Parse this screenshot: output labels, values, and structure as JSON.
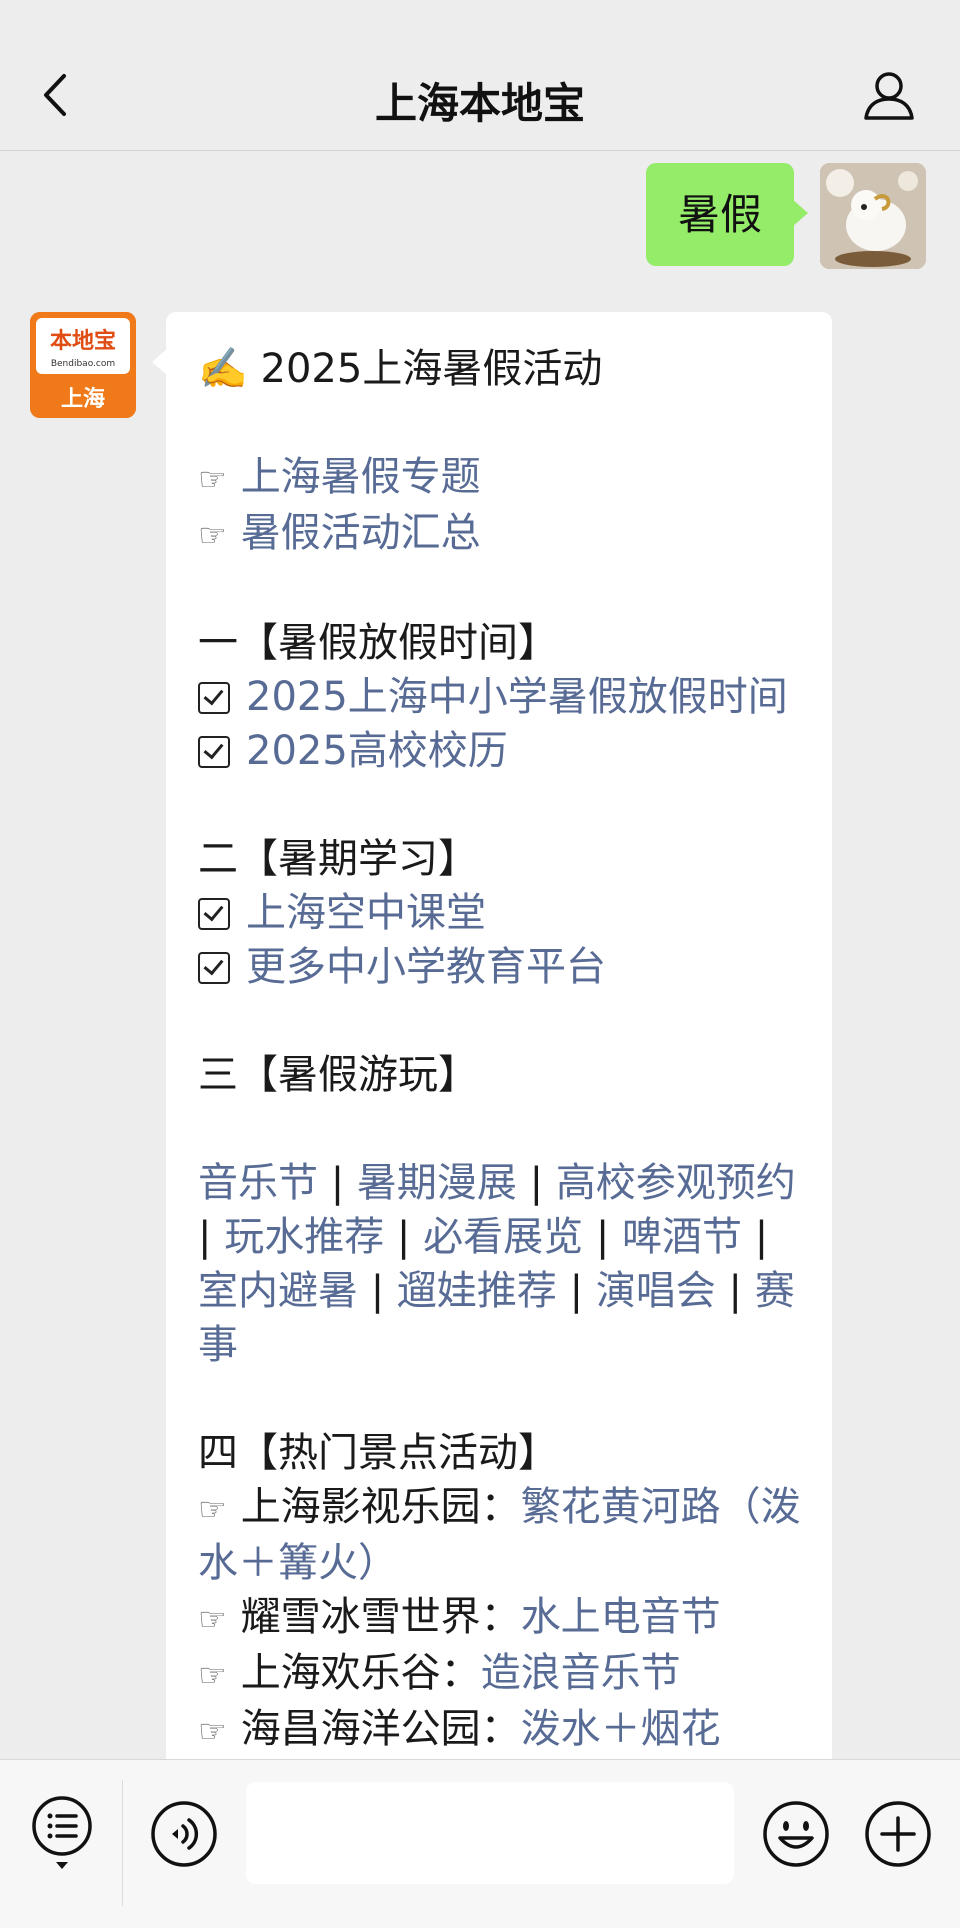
{
  "header": {
    "title": "上海本地宝",
    "back_icon": "chevron-left-icon",
    "profile_icon": "person-icon"
  },
  "outgoing": {
    "text": "暑假",
    "bubble_color": "#95ec69"
  },
  "brand_avatar": {
    "line1": "本地宝",
    "line2": "Bendibao.com",
    "line3": "上海",
    "color": "#f07a1a"
  },
  "message": {
    "title_emoji": "✍️",
    "title": "2025上海暑假活动",
    "pointer_symbol": "☞",
    "top_links": [
      "上海暑假专题",
      "暑假活动汇总"
    ],
    "section1": {
      "heading": "一【暑假放假时间】",
      "items": [
        "2025上海中小学暑假放假时间",
        "2025高校校历"
      ]
    },
    "section2": {
      "heading": "二【暑期学习】",
      "items": [
        "上海空中课堂",
        "更多中小学教育平台"
      ]
    },
    "section3": {
      "heading": "三【暑假游玩】",
      "links": [
        "音乐节",
        "暑期漫展",
        "高校参观预约",
        "玩水推荐",
        "必看展览",
        "啤酒节",
        "室内避暑",
        "遛娃推荐",
        "演唱会",
        "赛事"
      ],
      "separator": " | "
    },
    "section4": {
      "heading": "四【热门景点活动】",
      "items": [
        {
          "place": "上海影视乐园：",
          "link": "繁花黄河路（泼水＋篝火）"
        },
        {
          "place": "耀雪冰雪世界：",
          "link": "水上电音节"
        },
        {
          "place": "上海欢乐谷：",
          "link": "造浪音乐节"
        },
        {
          "place": "海昌海洋公园：",
          "link": "泼水＋烟花"
        }
      ]
    },
    "link_color": "#576b95"
  },
  "input_bar": {
    "menu_icon": "list-menu-icon",
    "voice_icon": "voice-icon",
    "emoji_icon": "emoji-icon",
    "plus_icon": "plus-icon"
  }
}
